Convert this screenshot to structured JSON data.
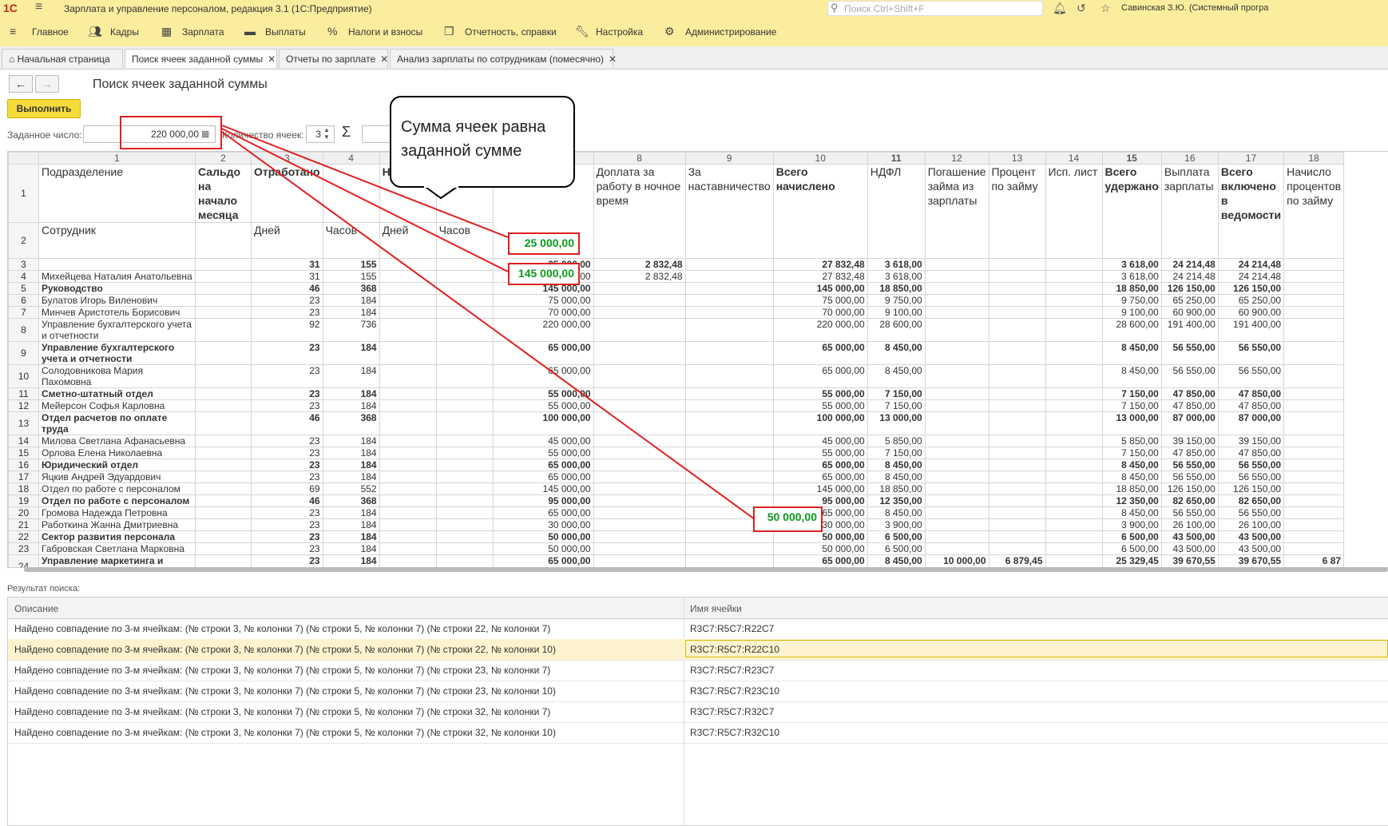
{
  "app": {
    "logo": "1С",
    "title": "Зарплата и управление персоналом, редакция 3.1  (1С:Предприятие)",
    "search_placeholder": "Поиск Ctrl+Shift+F",
    "user": "Савинская З.Ю. (Системный програ"
  },
  "menu": [
    "Главное",
    "Кадры",
    "Зарплата",
    "Выплаты",
    "Налоги и взносы",
    "Отчетность, справки",
    "Настройка",
    "Администрирование"
  ],
  "tabs": [
    "Начальная страница",
    "Поиск ячеек заданной суммы",
    "Отчеты по зарплате",
    "Анализ зарплаты по сотрудникам (помесячно)"
  ],
  "form": {
    "title": "Поиск ячеек заданной суммы",
    "run_label": "Выполнить",
    "target_label": "Заданное число:",
    "target_value": "220 000,00",
    "count_label": "Количество ячеек:",
    "count_value": "3",
    "sigma": "Σ"
  },
  "grid": {
    "col_numbers": [
      "1",
      "2",
      "3",
      "4",
      "5",
      "6",
      "7",
      "8",
      "9",
      "10",
      "11",
      "12",
      "13",
      "14",
      "15",
      "16",
      "17",
      "18"
    ],
    "header1": [
      "Подразделение",
      "Сальдо на начало месяца",
      "Отработано",
      "",
      "Не",
      "",
      "",
      "Доплата за работу в ночное время",
      "За наставничество",
      "Всего начислено",
      "НДФЛ",
      "Погашение займа из зарплаты",
      "Процент по займу",
      "Исп. лист",
      "Всего удержано",
      "Выплата зарплаты",
      "Всего включено в ведомости",
      "Начисло процентов по займу"
    ],
    "header2": [
      "Сотрудник",
      "",
      "Дней",
      "Часов",
      "Дней",
      "Часов"
    ],
    "rows": [
      {
        "n": "3",
        "name": "",
        "b": true,
        "v": [
          "",
          "31",
          "155",
          "",
          "",
          "25 000,00",
          "2 832,48",
          "",
          "27 832,48",
          "3 618,00",
          "",
          "",
          "",
          "3 618,00",
          "24 214,48",
          "24 214,48",
          ""
        ]
      },
      {
        "n": "4",
        "name": "Михейцева Наталия Анатольевна",
        "b": false,
        "v": [
          "",
          "31",
          "155",
          "",
          "",
          "25 000,00",
          "2 832,48",
          "",
          "27 832,48",
          "3 618,00",
          "",
          "",
          "",
          "3 618,00",
          "24 214,48",
          "24 214,48",
          ""
        ]
      },
      {
        "n": "5",
        "name": "Руководство",
        "b": true,
        "v": [
          "",
          "46",
          "368",
          "",
          "",
          "145 000,00",
          "",
          "",
          "145 000,00",
          "18 850,00",
          "",
          "",
          "",
          "18 850,00",
          "126 150,00",
          "126 150,00",
          ""
        ]
      },
      {
        "n": "6",
        "name": "Булатов Игорь Виленович",
        "b": false,
        "v": [
          "",
          "23",
          "184",
          "",
          "",
          "75 000,00",
          "",
          "",
          "75 000,00",
          "9 750,00",
          "",
          "",
          "",
          "9 750,00",
          "65 250,00",
          "65 250,00",
          ""
        ]
      },
      {
        "n": "7",
        "name": "Минчев Аристотель Борисович",
        "b": false,
        "v": [
          "",
          "23",
          "184",
          "",
          "",
          "70 000,00",
          "",
          "",
          "70 000,00",
          "9 100,00",
          "",
          "",
          "",
          "9 100,00",
          "60 900,00",
          "60 900,00",
          ""
        ]
      },
      {
        "n": "8",
        "name": "Управление бухгалтерского учета и отчетности",
        "b": false,
        "tall": true,
        "v": [
          "",
          "92",
          "736",
          "",
          "",
          "220 000,00",
          "",
          "",
          "220 000,00",
          "28 600,00",
          "",
          "",
          "",
          "28 600,00",
          "191 400,00",
          "191 400,00",
          ""
        ]
      },
      {
        "n": "9",
        "name": "Управление бухгалтерского учета и отчетности",
        "b": true,
        "tall": true,
        "v": [
          "",
          "23",
          "184",
          "",
          "",
          "65 000,00",
          "",
          "",
          "65 000,00",
          "8 450,00",
          "",
          "",
          "",
          "8 450,00",
          "56 550,00",
          "56 550,00",
          ""
        ]
      },
      {
        "n": "10",
        "name": "Солодовникова Мария Пахомовна",
        "b": false,
        "v": [
          "",
          "23",
          "184",
          "",
          "",
          "65 000,00",
          "",
          "",
          "65 000,00",
          "8 450,00",
          "",
          "",
          "",
          "8 450,00",
          "56 550,00",
          "56 550,00",
          ""
        ]
      },
      {
        "n": "11",
        "name": "Сметно-штатный отдел",
        "b": true,
        "v": [
          "",
          "23",
          "184",
          "",
          "",
          "55 000,00",
          "",
          "",
          "55 000,00",
          "7 150,00",
          "",
          "",
          "",
          "7 150,00",
          "47 850,00",
          "47 850,00",
          ""
        ]
      },
      {
        "n": "12",
        "name": "Мейерсон Софья Карловна",
        "b": false,
        "v": [
          "",
          "23",
          "184",
          "",
          "",
          "55 000,00",
          "",
          "",
          "55 000,00",
          "7 150,00",
          "",
          "",
          "",
          "7 150,00",
          "47 850,00",
          "47 850,00",
          ""
        ]
      },
      {
        "n": "13",
        "name": "Отдел расчетов по оплате труда",
        "b": true,
        "tall": true,
        "v": [
          "",
          "46",
          "368",
          "",
          "",
          "100 000,00",
          "",
          "",
          "100 000,00",
          "13 000,00",
          "",
          "",
          "",
          "13 000,00",
          "87 000,00",
          "87 000,00",
          ""
        ]
      },
      {
        "n": "14",
        "name": "Милова Светлана Афанасьевна",
        "b": false,
        "v": [
          "",
          "23",
          "184",
          "",
          "",
          "45 000,00",
          "",
          "",
          "45 000,00",
          "5 850,00",
          "",
          "",
          "",
          "5 850,00",
          "39 150,00",
          "39 150,00",
          ""
        ]
      },
      {
        "n": "15",
        "name": "Орлова Елена Николаевна",
        "b": false,
        "v": [
          "",
          "23",
          "184",
          "",
          "",
          "55 000,00",
          "",
          "",
          "55 000,00",
          "7 150,00",
          "",
          "",
          "",
          "7 150,00",
          "47 850,00",
          "47 850,00",
          ""
        ]
      },
      {
        "n": "16",
        "name": "Юридический отдел",
        "b": true,
        "v": [
          "",
          "23",
          "184",
          "",
          "",
          "65 000,00",
          "",
          "",
          "65 000,00",
          "8 450,00",
          "",
          "",
          "",
          "8 450,00",
          "56 550,00",
          "56 550,00",
          ""
        ]
      },
      {
        "n": "17",
        "name": "Яцкив Андрей Эдуардович",
        "b": false,
        "v": [
          "",
          "23",
          "184",
          "",
          "",
          "65 000,00",
          "",
          "",
          "65 000,00",
          "8 450,00",
          "",
          "",
          "",
          "8 450,00",
          "56 550,00",
          "56 550,00",
          ""
        ]
      },
      {
        "n": "18",
        "name": "Отдел по работе с персоналом",
        "b": false,
        "v": [
          "",
          "69",
          "552",
          "",
          "",
          "145 000,00",
          "",
          "",
          "145 000,00",
          "18 850,00",
          "",
          "",
          "",
          "18 850,00",
          "126 150,00",
          "126 150,00",
          ""
        ]
      },
      {
        "n": "19",
        "name": "Отдел по работе с персоналом",
        "b": true,
        "v": [
          "",
          "46",
          "368",
          "",
          "",
          "95 000,00",
          "",
          "",
          "95 000,00",
          "12 350,00",
          "",
          "",
          "",
          "12 350,00",
          "82 650,00",
          "82 650,00",
          ""
        ]
      },
      {
        "n": "20",
        "name": "Громова Надежда Петровна",
        "b": false,
        "v": [
          "",
          "23",
          "184",
          "",
          "",
          "65 000,00",
          "",
          "",
          "65 000,00",
          "8 450,00",
          "",
          "",
          "",
          "8 450,00",
          "56 550,00",
          "56 550,00",
          ""
        ]
      },
      {
        "n": "21",
        "name": "Работкина Жанна Дмитриевна",
        "b": false,
        "v": [
          "",
          "23",
          "184",
          "",
          "",
          "30 000,00",
          "",
          "",
          "30 000,00",
          "3 900,00",
          "",
          "",
          "",
          "3 900,00",
          "26 100,00",
          "26 100,00",
          ""
        ]
      },
      {
        "n": "22",
        "name": "Сектор развития персонала",
        "b": true,
        "v": [
          "",
          "23",
          "184",
          "",
          "",
          "50 000,00",
          "",
          "",
          "50 000,00",
          "6 500,00",
          "",
          "",
          "",
          "6 500,00",
          "43 500,00",
          "43 500,00",
          ""
        ]
      },
      {
        "n": "23",
        "name": "Габровская Светлана Марковна",
        "b": false,
        "v": [
          "",
          "23",
          "184",
          "",
          "",
          "50 000,00",
          "",
          "",
          "50 000,00",
          "6 500,00",
          "",
          "",
          "",
          "6 500,00",
          "43 500,00",
          "43 500,00",
          ""
        ]
      },
      {
        "n": "24",
        "name": "Управление маркетинга и обслуживания клиентов",
        "b": true,
        "tall": true,
        "v": [
          "",
          "23",
          "184",
          "",
          "",
          "65 000,00",
          "",
          "",
          "65 000,00",
          "8 450,00",
          "10 000,00",
          "6 879,45",
          "",
          "25 329,45",
          "39 670,55",
          "39 670,55",
          "6 87"
        ]
      }
    ]
  },
  "highlights": {
    "h1": "25 000,00",
    "h2": "145 000,00",
    "h3": "50 000,00"
  },
  "callout": "Сумма ячеек равна заданной сумме",
  "results": {
    "label": "Результат поиска:",
    "col_desc": "Описание",
    "col_cell": "Имя ячейки",
    "rows": [
      {
        "desc": "Найдено совпадение по 3-м ячейкам: (№ строки 3, № колонки 7) (№ строки 5, № колонки 7) (№ строки 22, № колонки 7)",
        "cell": "R3C7:R5C7:R22C7"
      },
      {
        "desc": "Найдено совпадение по 3-м ячейкам: (№ строки 3, № колонки 7) (№ строки 5, № колонки 7) (№ строки 22, № колонки 10)",
        "cell": "R3C7:R5C7:R22C10"
      },
      {
        "desc": "Найдено совпадение по 3-м ячейкам: (№ строки 3, № колонки 7) (№ строки 5, № колонки 7) (№ строки 23, № колонки 7)",
        "cell": "R3C7:R5C7:R23C7"
      },
      {
        "desc": "Найдено совпадение по 3-м ячейкам: (№ строки 3, № колонки 7) (№ строки 5, № колонки 7) (№ строки 23, № колонки 10)",
        "cell": "R3C7:R5C7:R23C10"
      },
      {
        "desc": "Найдено совпадение по 3-м ячейкам: (№ строки 3, № колонки 7) (№ строки 5, № колонки 7) (№ строки 32, № колонки 7)",
        "cell": "R3C7:R5C7:R32C7"
      },
      {
        "desc": "Найдено совпадение по 3-м ячейкам: (№ строки 3, № колонки 7) (№ строки 5, № колонки 7) (№ строки 32, № колонки 10)",
        "cell": "R3C7:R5C7:R32C10"
      }
    ]
  }
}
